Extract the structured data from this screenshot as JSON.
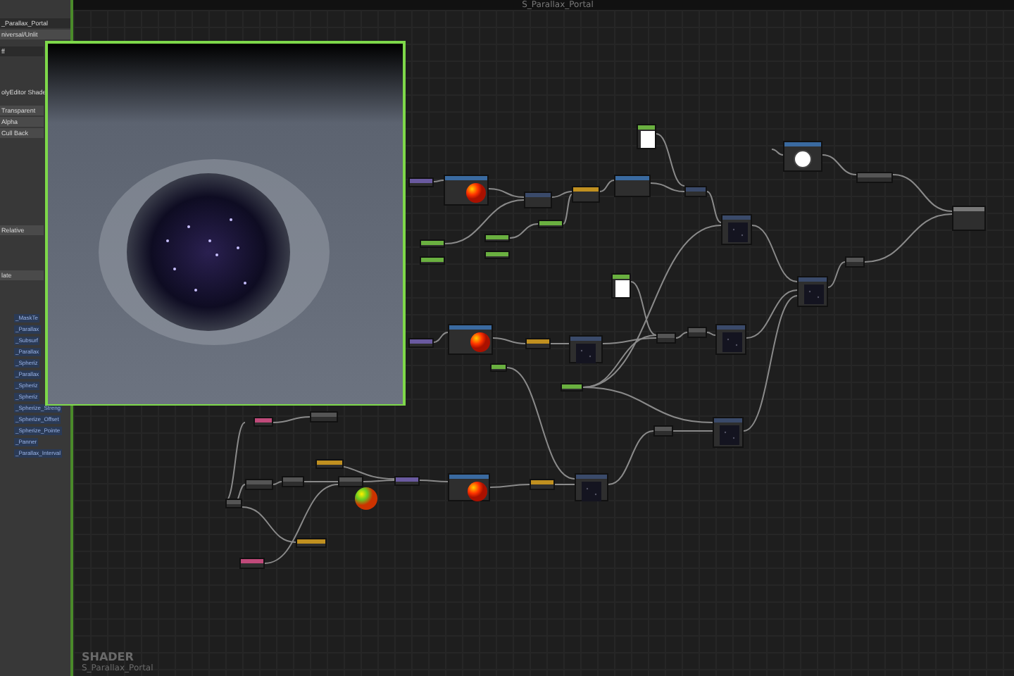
{
  "window": {
    "title": "S_Parallax_Portal"
  },
  "properties_panel": {
    "fields": [
      {
        "kind": "field",
        "value": "_Parallax_Portal"
      },
      {
        "kind": "dropdown",
        "value": "niversal/Unlit"
      },
      {
        "kind": "field",
        "value": "ff"
      },
      {
        "kind": "label",
        "value": "olyEditor Shade"
      },
      {
        "kind": "dropdown",
        "value": "Transparent"
      },
      {
        "kind": "dropdown",
        "value": "Alpha"
      },
      {
        "kind": "dropdown",
        "value": "Cull Back"
      },
      {
        "kind": "dropdown",
        "value": "Relative"
      },
      {
        "kind": "dropdown",
        "value": "late"
      }
    ],
    "property_list": [
      "_MaskTe",
      "_Parallax",
      "_Subsurf",
      "_Parallax",
      "_Spheriz",
      "_Parallax",
      "_Spheriz",
      "_Spheriz",
      "_Spherize_Streng",
      "_Spherize_Offset",
      "_Spherize_Pointe",
      "_Panner",
      "_Parallax_Interval"
    ]
  },
  "footer": {
    "type": "SHADER",
    "name": "S_Parallax_Portal"
  }
}
